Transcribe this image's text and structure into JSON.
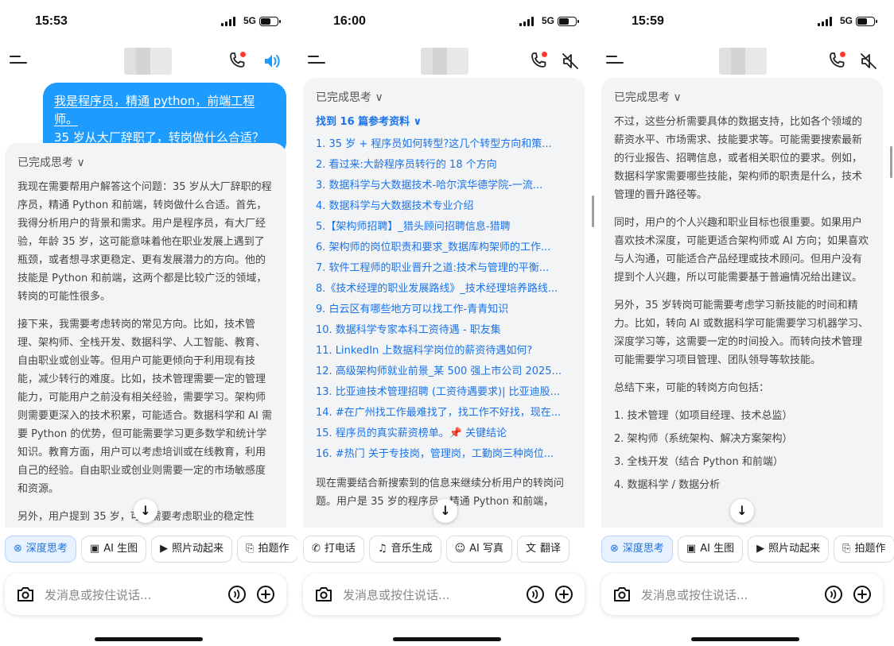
{
  "screens": [
    {
      "time": "15:53",
      "network": "5G",
      "user_message_line1": "我是程序员，精通 python，前端工程师。",
      "user_message_line2": "35 岁从大厂辞职了，转岗做什么合适？",
      "think_label": "已完成思考 ∨",
      "paragraphs": [
        "我现在需要帮用户解答这个问题：35 岁从大厂辞职的程序员，精通 Python 和前端，转岗做什么合适。首先，我得分析用户的背景和需求。用户是程序员，有大厂经验，年龄 35 岁，这可能意味着他在职业发展上遇到了瓶颈，或者想寻求更稳定、更有发展潜力的方向。他的技能是 Python 和前端，这两个都是比较广泛的领域，转岗的可能性很多。",
        "接下来，我需要考虑转岗的常见方向。比如，技术管理、架构师、全栈开发、数据科学、人工智能、教育、自由职业或创业等。但用户可能更倾向于利用现有技能，减少转行的难度。比如，技术管理需要一定的管理能力，可能用户之前没有相关经验，需要学习。架构师则需要更深入的技术积累，可能适合。数据科学和 AI 需要 Python 的优势，但可能需要学习更多数学和统计学知识。教育方面，用户可以考虑培训或在线教育，利用自己的经验。自由职业或创业则需要一定的市场敏感度和资源。",
        "另外，用户提到 35 岁，可能需要考虑职业的稳定性"
      ],
      "chips": [
        {
          "icon": "⊗",
          "label": "深度思考"
        },
        {
          "icon": "▣",
          "label": "AI 生图"
        },
        {
          "icon": "▶",
          "label": "照片动起来"
        },
        {
          "icon": "⎘",
          "label": "拍题作"
        }
      ],
      "input_placeholder": "发消息或按住说话..."
    },
    {
      "time": "16:00",
      "network": "5G",
      "think_label": "已完成思考 ∨",
      "refs_label": "找到 16 篇参考资料 ∨",
      "refs": [
        "1. 35 岁 + 程序员如何转型?这几个转型方向和策...",
        "2. 看过来:大龄程序员转行的 18 个方向",
        "3. 数据科学与大数据技术-哈尔滨华德学院-一流...",
        "4. 数据科学与大数据技术专业介绍",
        "5.【架构师招聘】_猎头顾问招聘信息-猎聘",
        "6. 架构师的岗位职责和要求_数据库构架师的工作...",
        "7. 软件工程师的职业晋升之道:技术与管理的平衡...",
        "8.《技术经理的职业发展路线》_技术经理培养路线...",
        "9. 白云区有哪些地方可以找工作-青青知识",
        "10. 数据科学专家本科工资待遇 - 职友集",
        "11. LinkedIn 上数据科学岗位的薪资待遇如何?",
        "12. 高级架构师就业前景_某 500 强上市公司 2025...",
        "13. 比亚迪技术管理招聘 (工资待遇要求)| 比亚迪股...",
        "14. #在广州找工作最难找了，找工作不好找，现在...",
        "15. 程序员的真实薪资榜单。📌 关键结论",
        "16. #热门 关于专技岗，管理岗，工勤岗三种岗位..."
      ],
      "paragraph": "现在需要结合新搜索到的信息来继续分析用户的转岗问题。用户是 35 岁的程序员，精通 Python 和前端，",
      "chips": [
        {
          "icon": "✆",
          "label": "打电话"
        },
        {
          "icon": "♫",
          "label": "音乐生成"
        },
        {
          "icon": "☺",
          "label": "AI 写真"
        },
        {
          "icon": "文",
          "label": "翻译"
        }
      ],
      "input_placeholder": "发消息或按住说话..."
    },
    {
      "time": "15:59",
      "network": "5G",
      "think_label": "已完成思考 ∨",
      "paragraphs": [
        "不过，这些分析需要具体的数据支持，比如各个领域的薪资水平、市场需求、技能要求等。可能需要搜索最新的行业报告、招聘信息，或者相关职位的要求。例如，数据科学家需要哪些技能，架构师的职责是什么，技术管理的晋升路径等。",
        "同时，用户的个人兴趣和职业目标也很重要。如果用户喜欢技术深度，可能更适合架构师或 AI 方向；如果喜欢与人沟通，可能适合产品经理或技术顾问。但用户没有提到个人兴趣，所以可能需要基于普遍情况给出建议。",
        "另外，35 岁转岗可能需要考虑学习新技能的时间和精力。比如，转向 AI 或数据科学可能需要学习机器学习、深度学习等，这需要一定的时间投入。而转向技术管理可能需要学习项目管理、团队领导等软技能。",
        "总结下来，可能的转岗方向包括："
      ],
      "list": [
        "1. 技术管理（如项目经理、技术总监）",
        "2. 架构师（系统架构、解决方案架构）",
        "3. 全栈开发（结合 Python 和前端）",
        "4. 数据科学 / 数据分析"
      ],
      "chips": [
        {
          "icon": "⊗",
          "label": "深度思考"
        },
        {
          "icon": "▣",
          "label": "AI 生图"
        },
        {
          "icon": "▶",
          "label": "照片动起来"
        },
        {
          "icon": "⎘",
          "label": "拍题作"
        }
      ],
      "input_placeholder": "发消息或按住说话..."
    }
  ],
  "colors": {
    "accent": "#1e9bff",
    "link": "#1a73e8",
    "missed_call_dot": "#ff3b30"
  }
}
